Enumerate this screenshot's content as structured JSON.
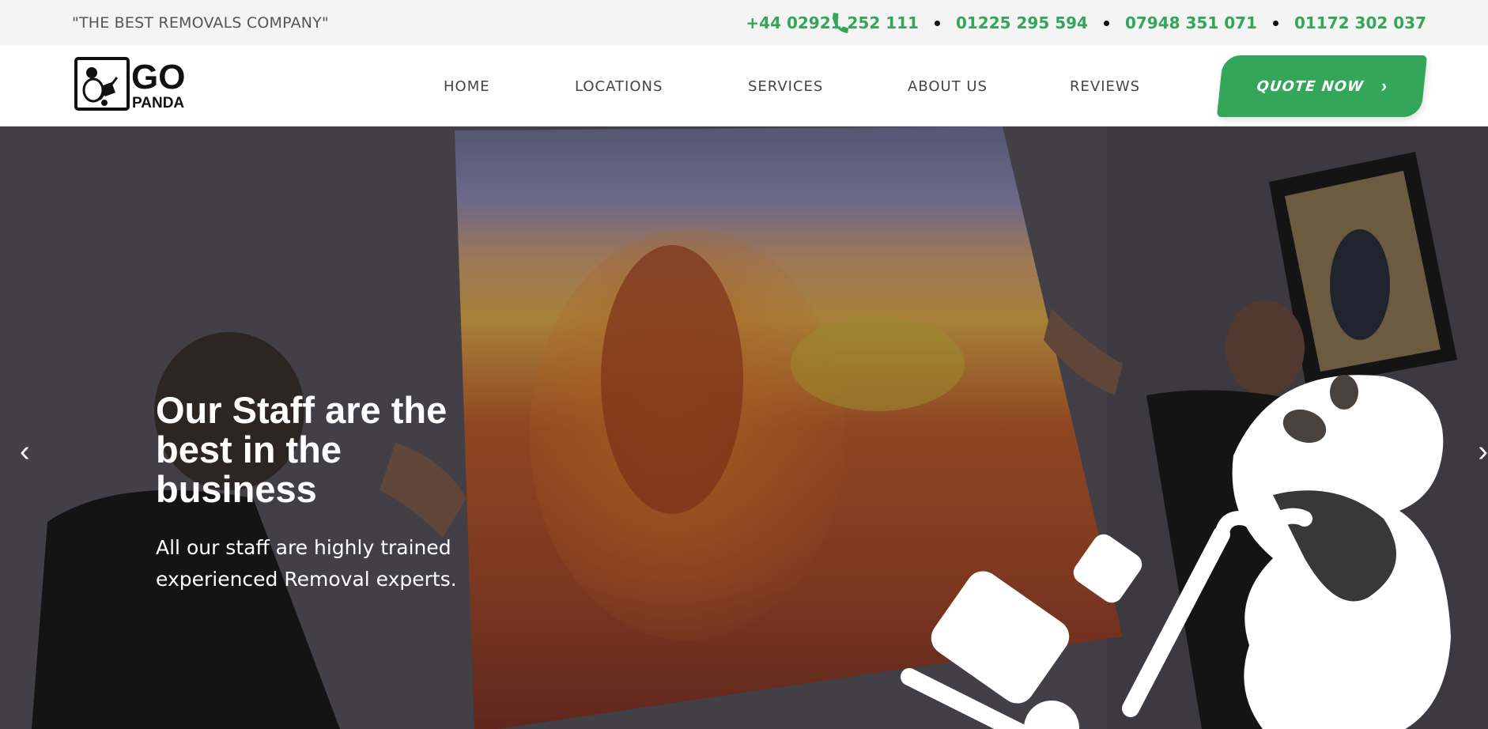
{
  "topbar": {
    "tagline": "\"THE BEST REMOVALS COMPANY\"",
    "phones": [
      "+44 02921 252 111",
      "01225 295 594",
      "07948 351 071",
      "01172 302 037"
    ],
    "icon": "phone-icon"
  },
  "header": {
    "logo_text_top": "GO",
    "logo_text_bottom": "PANDA",
    "nav": [
      "HOME",
      "LOCATIONS",
      "SERVICES",
      "ABOUT US",
      "REVIEWS"
    ],
    "quote_label": "QUOTE NOW",
    "quote_icon": "chevron-right-icon"
  },
  "hero": {
    "title": "Our Staff are the best in the business",
    "subtitle": "All our staff are highly trained experienced Removal experts.",
    "prev_icon": "chevron-left-icon",
    "next_icon": "chevron-right-icon"
  },
  "colors": {
    "accent": "#33a65a",
    "topbar_bg": "#f4f4f4",
    "text_dark": "#444444"
  }
}
